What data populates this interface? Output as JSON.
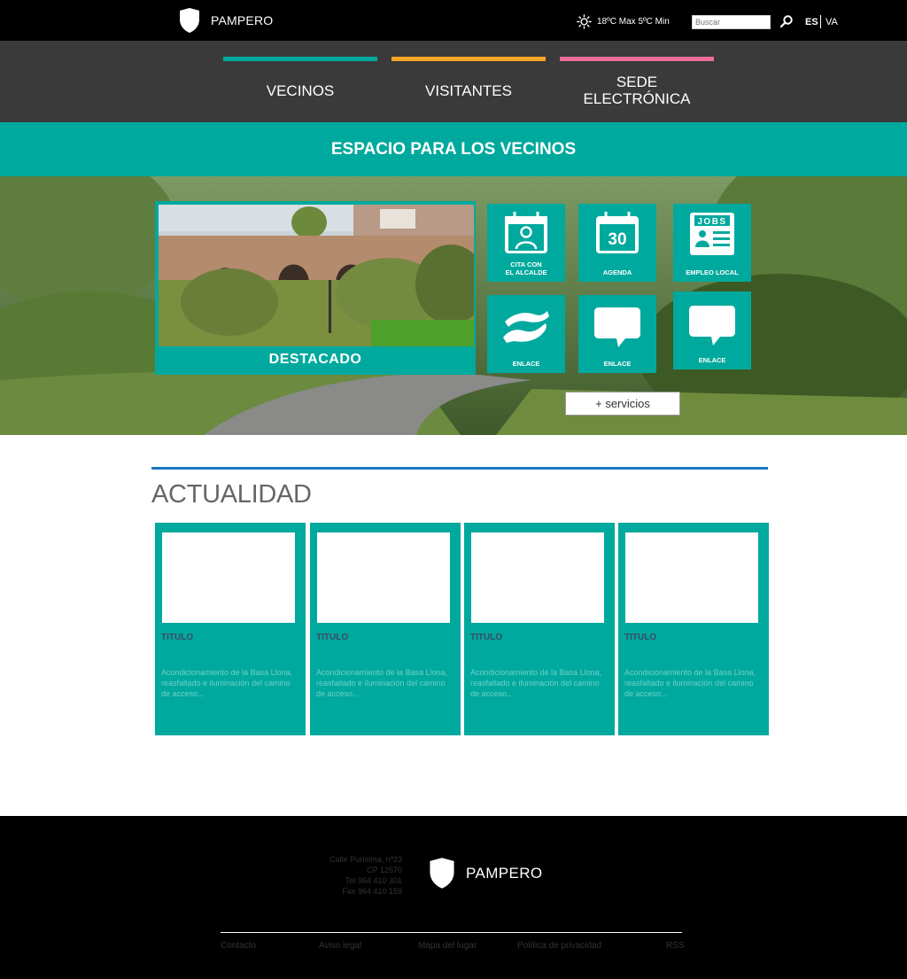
{
  "header": {
    "brand": "PAMPERO",
    "weather": "18ºC Max 5ºC Min",
    "search_placeholder": "Buscar",
    "languages": [
      "ES",
      "VA"
    ]
  },
  "nav": {
    "tabs": [
      {
        "label": "VECINOS",
        "color": "#00a99d"
      },
      {
        "label": "VISITANTES",
        "color": "#f5a623"
      },
      {
        "label": "SEDE\nELECTRÓNICA",
        "color": "#f06c9b"
      }
    ]
  },
  "band": {
    "title": "ESPACIO PARA LOS VECINOS"
  },
  "hero": {
    "featured_label": "DESTACADO",
    "tiles": [
      {
        "label": "CITA CON\nEL ALCALDE",
        "icon": "calendar-person-icon"
      },
      {
        "label": "AGENDA",
        "icon": "calendar-30-icon",
        "day": "30"
      },
      {
        "label": "EMPLEO LOCAL",
        "icon": "jobs-icon",
        "badge": "JOBS"
      },
      {
        "label": "ENLACE",
        "icon": "helping-hands-icon"
      },
      {
        "label": "ENLACE",
        "icon": "speech-bubble-icon"
      },
      {
        "label": "ENLACE",
        "icon": "speech-bubble-icon"
      }
    ],
    "more_services": "+ servicios"
  },
  "news": {
    "heading": "ACTUALIDAD",
    "cards": [
      {
        "title": "TITULO",
        "text": "Acondicionamiento de la Basa Llona, reasfaltado e iluminación del camino de acceso..."
      },
      {
        "title": "TITULO",
        "text": "Acondicionamiento de la Basa Llona, reasfaltado e iluminación del camino de acceso..."
      },
      {
        "title": "TITULO",
        "text": "Acondicionamiento de la Basa Llona, reasfaltado e iluminación del camino de acceso..."
      },
      {
        "title": "TITULO",
        "text": "Acondicionamiento de la Basa Llona, reasfaltado e iluminación del camino de acceso..."
      }
    ]
  },
  "footer": {
    "address": [
      "Calle Purísima, nº23",
      "CP 12570",
      "Tel 964 410 301",
      "Fax 964 410 159"
    ],
    "brand": "PAMPERO",
    "links": [
      "Contacto",
      "Aviso legal",
      "Mapa del lugar",
      "Política de privacidad",
      "RSS"
    ]
  },
  "colors": {
    "teal": "#00a99d",
    "orange": "#f5a623",
    "pink": "#f06c9b",
    "blue_rule": "#1a78c2"
  }
}
